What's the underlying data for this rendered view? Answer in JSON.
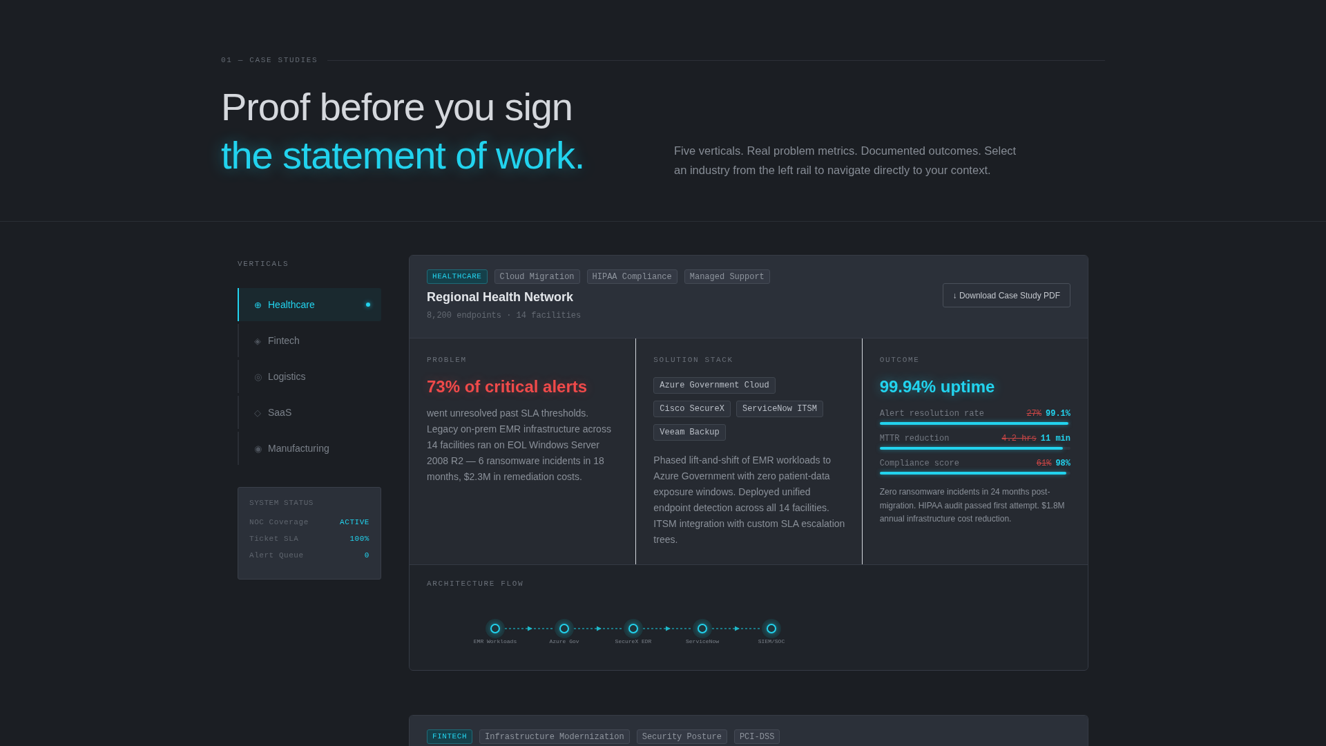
{
  "section": {
    "eyebrow": "01 — CASE STUDIES",
    "headline": "Proof before you sign",
    "headline_accent": "the statement of work.",
    "intro": "Five verticals. Real problem metrics. Documented outcomes. Select an industry from the left rail to navigate directly to your context."
  },
  "sidebar": {
    "title": "VERTICALS",
    "items": [
      {
        "glyph": "⊕",
        "label": "Healthcare",
        "selected": true
      },
      {
        "glyph": "◈",
        "label": "Fintech",
        "selected": false
      },
      {
        "glyph": "◎",
        "label": "Logistics",
        "selected": false
      },
      {
        "glyph": "◇",
        "label": "SaaS",
        "selected": false
      },
      {
        "glyph": "◉",
        "label": "Manufacturing",
        "selected": false
      }
    ],
    "status": {
      "title": "SYSTEM STATUS",
      "rows": [
        {
          "label": "NOC Coverage",
          "value": "ACTIVE"
        },
        {
          "label": "Ticket SLA",
          "value": "100%"
        },
        {
          "label": "Alert Queue",
          "value": "0"
        }
      ]
    }
  },
  "case_studies": [
    {
      "tags": [
        {
          "label": "HEALTHCARE",
          "kind": "vertical"
        },
        {
          "label": "Cloud Migration",
          "kind": "service"
        },
        {
          "label": "HIPAA Compliance",
          "kind": "service"
        },
        {
          "label": "Managed Support",
          "kind": "service"
        }
      ],
      "title": "Regional Health Network",
      "meta": "8,200 endpoints · 14 facilities",
      "download_button": "↓ Download Case Study PDF",
      "problem": {
        "heading": "PROBLEM",
        "headline": "73% of critical alerts",
        "body": "went unresolved past SLA thresholds. Legacy on-prem EMR infrastructure across 14 facilities ran on EOL Windows Server 2008 R2 — 6 ransomware incidents in 18 months, $2.3M in remediation costs."
      },
      "solution": {
        "heading": "SOLUTION STACK",
        "stack": [
          "Azure Government Cloud",
          "Cisco SecureX",
          "ServiceNow ITSM",
          "Veeam Backup"
        ],
        "body": "Phased lift-and-shift of EMR workloads to Azure Government with zero patient-data exposure windows. Deployed unified endpoint detection across all 14 facilities. ITSM integration with custom SLA escalation trees."
      },
      "outcome": {
        "heading": "OUTCOME",
        "headline": "99.94% uptime",
        "metrics": [
          {
            "label": "Alert resolution rate",
            "before": "27%",
            "after": "99.1%",
            "level": 0.99
          },
          {
            "label": "MTTR reduction",
            "before": "4.2 hrs",
            "after": "11 min",
            "level": 0.96
          },
          {
            "label": "Compliance score",
            "before": "61%",
            "after": "98%",
            "level": 0.98
          }
        ],
        "body": "Zero ransomware incidents in 24 months post-migration. HIPAA audit passed first attempt. $1.8M annual infrastructure cost reduction."
      },
      "architecture": {
        "heading": "ARCHITECTURE FLOW",
        "nodes": [
          {
            "label": "EMR Workloads"
          },
          {
            "label": "Azure Gov"
          },
          {
            "label": "SecureX EDR"
          },
          {
            "label": "ServiceNow"
          },
          {
            "label": "SIEM/SOC"
          }
        ]
      }
    },
    {
      "tags": [
        {
          "label": "FINTECH",
          "kind": "vertical"
        },
        {
          "label": "Infrastructure Modernization",
          "kind": "service"
        },
        {
          "label": "Security Posture",
          "kind": "service"
        },
        {
          "label": "PCI-DSS",
          "kind": "service"
        }
      ]
    }
  ]
}
